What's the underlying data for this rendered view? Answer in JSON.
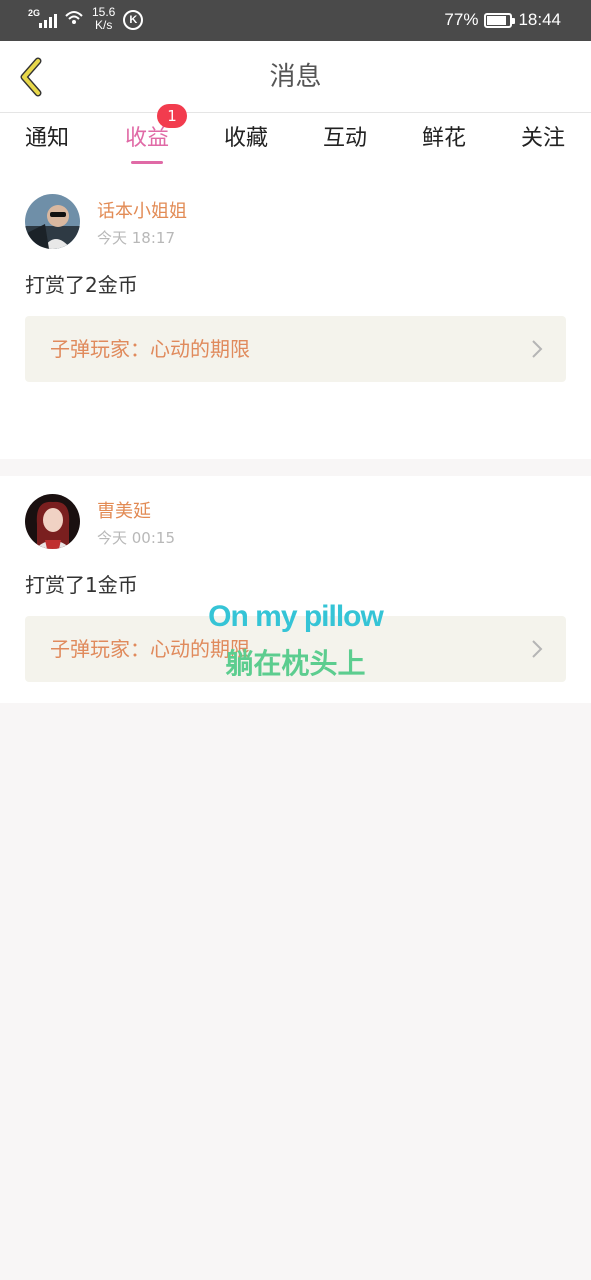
{
  "status_bar": {
    "network": "2G",
    "speed_value": "15.6",
    "speed_unit": "K/s",
    "app_icon": "K",
    "battery": "77%",
    "time": "18:44"
  },
  "header": {
    "title": "消息",
    "back_icon": "chevron-left-icon"
  },
  "tabs": [
    {
      "label": "通知"
    },
    {
      "label": "收益",
      "active": true,
      "badge": "1"
    },
    {
      "label": "收藏"
    },
    {
      "label": "互动"
    },
    {
      "label": "鲜花"
    },
    {
      "label": "关注"
    }
  ],
  "messages": [
    {
      "username": "话本小姐姐",
      "time": "今天 18:17",
      "text": "打赏了2金币",
      "book": "子弹玩家：心动的期限"
    },
    {
      "username": "曺美延",
      "time": "今天 00:15",
      "text": "打赏了1金币",
      "book": "子弹玩家：心动的期限"
    }
  ],
  "overlay": {
    "english": "On my pillow",
    "chinese": "躺在枕头上"
  },
  "colors": {
    "accent": "#e06aa6",
    "badge": "#f23c4e",
    "username": "#e28b55",
    "back_icon": "#e8d84a"
  }
}
